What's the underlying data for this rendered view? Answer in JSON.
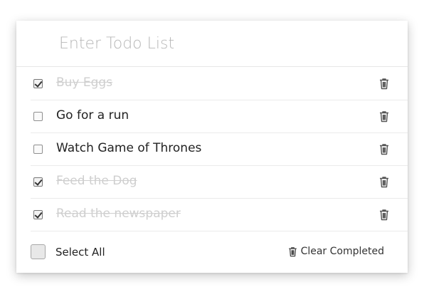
{
  "input": {
    "placeholder": "Enter Todo List"
  },
  "todos": [
    {
      "label": "Buy Eggs",
      "completed": true
    },
    {
      "label": "Go for a run",
      "completed": false
    },
    {
      "label": "Watch Game of Thrones",
      "completed": false
    },
    {
      "label": "Feed the Dog",
      "completed": true
    },
    {
      "label": "Read the newspaper",
      "completed": true
    }
  ],
  "footer": {
    "select_all_label": "Select All",
    "clear_completed_label": "Clear Completed"
  },
  "icons": {
    "delete": "trash-icon"
  },
  "colors": {
    "completed_text": "#cfcfcf",
    "text": "#222222"
  }
}
